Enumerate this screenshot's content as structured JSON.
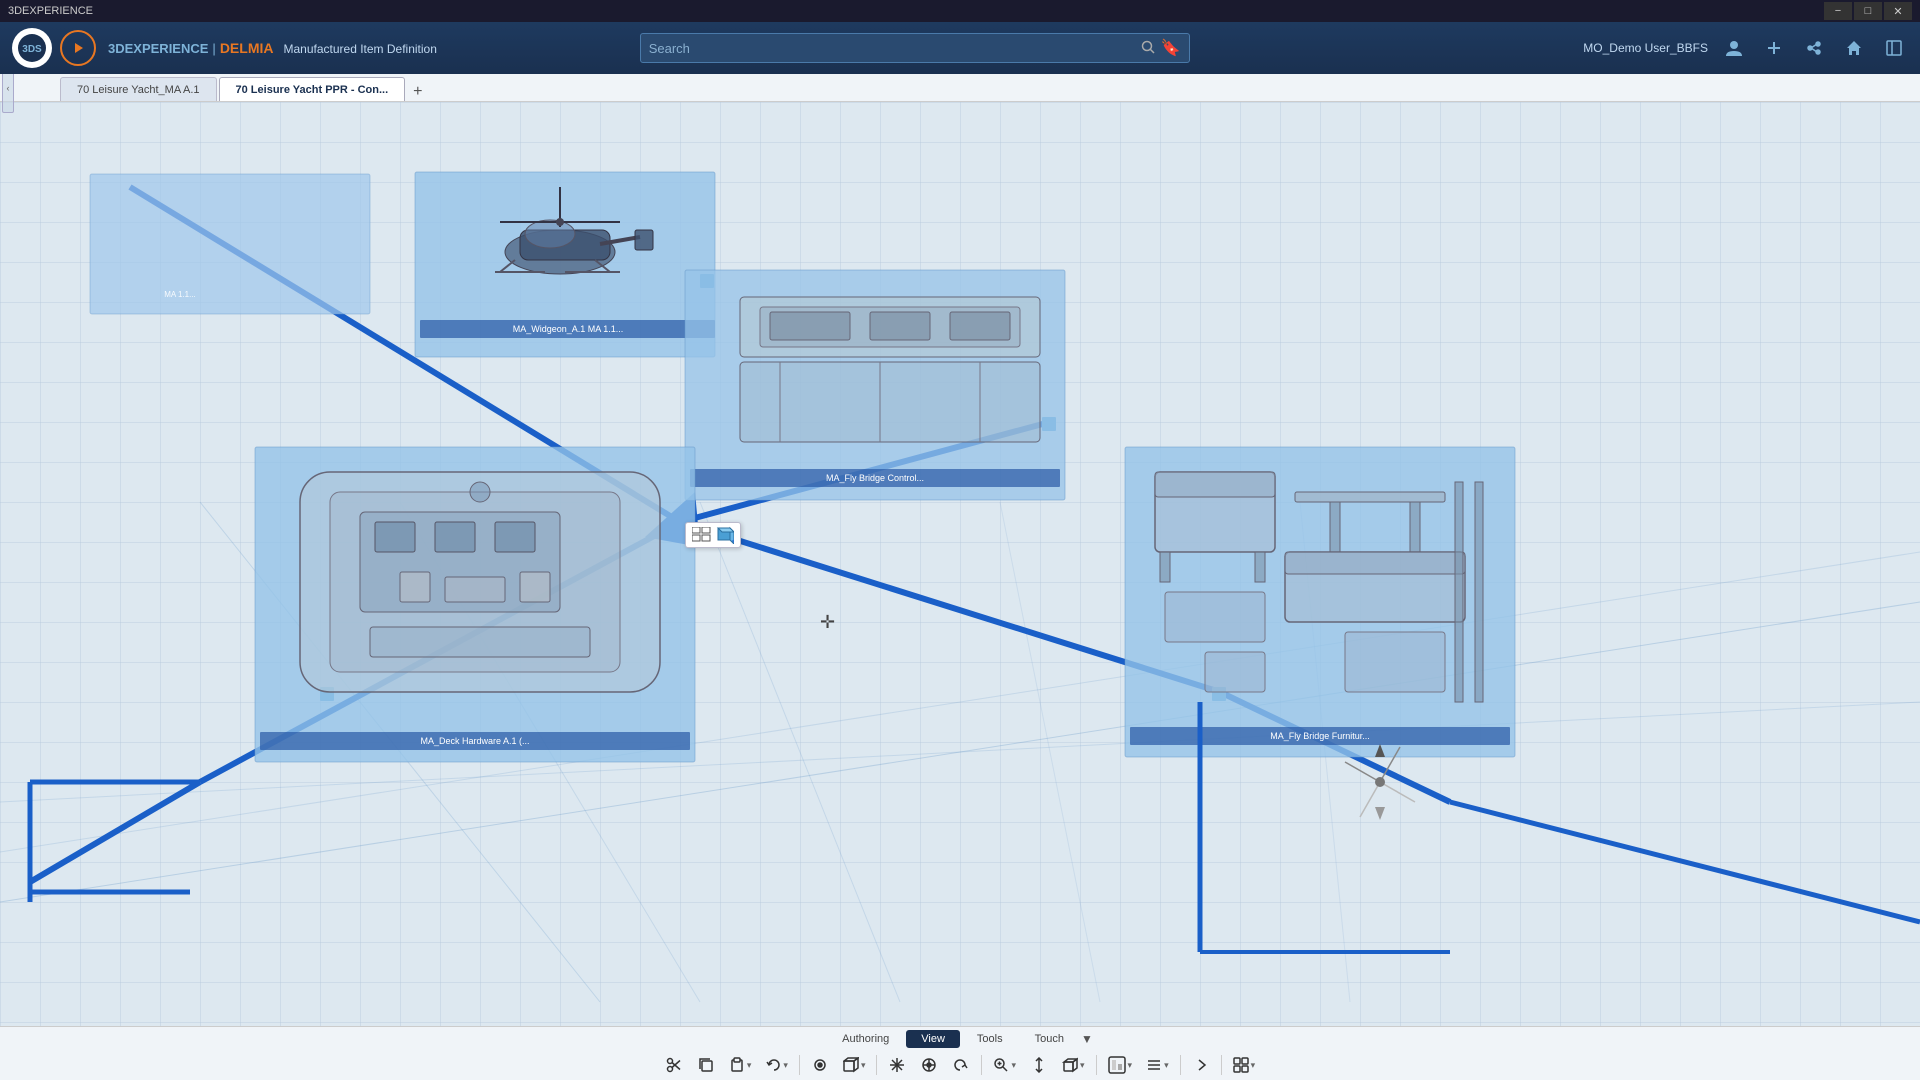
{
  "titlebar": {
    "title": "3DEXPERIENCE",
    "controls": [
      "minimize",
      "maximize",
      "close"
    ]
  },
  "header": {
    "brand_3dx": "3DEXPERIENCE",
    "separator": "|",
    "brand_delmia": "DELMIA",
    "module": "Manufactured Item Definition",
    "search_placeholder": "Search",
    "user": "MO_Demo User_BBFS",
    "icons": [
      "user",
      "plus",
      "share",
      "home",
      "expand"
    ]
  },
  "tabs": [
    {
      "label": "70 Leisure Yacht_MA A.1",
      "active": false
    },
    {
      "label": "70 Leisure Yacht PPR - Con...",
      "active": true
    }
  ],
  "cards": [
    {
      "id": "card-helicopter",
      "label": "MA_Widgeon_A.1 MA 1.1...",
      "has_indicator": true
    },
    {
      "id": "card-flybridge-ctrl",
      "label": "MA_Fly Bridge Control...",
      "has_indicator": true
    },
    {
      "id": "card-deck-hardware",
      "label": "MA_Deck Hardware A.1 (...",
      "has_indicator": true
    },
    {
      "id": "card-flybridge-furniture",
      "label": "MA_Fly Bridge Furnitur...",
      "has_indicator": true
    }
  ],
  "toolbar": {
    "tabs": [
      {
        "label": "Authoring",
        "active": false
      },
      {
        "label": "View",
        "active": true
      },
      {
        "label": "Tools",
        "active": false
      },
      {
        "label": "Touch",
        "active": false
      }
    ],
    "buttons": [
      {
        "icon": "✂",
        "label": "scissors",
        "has_dropdown": false
      },
      {
        "icon": "⬚",
        "label": "copy",
        "has_dropdown": false
      },
      {
        "icon": "⬚",
        "label": "paste",
        "has_dropdown": true
      },
      {
        "icon": "↶",
        "label": "undo",
        "has_dropdown": true
      },
      {
        "icon": "◎",
        "label": "fit",
        "has_dropdown": false
      },
      {
        "icon": "◻",
        "label": "cube-view",
        "has_dropdown": true
      },
      {
        "icon": "✛",
        "label": "multi-select",
        "has_dropdown": false
      },
      {
        "icon": "⊕",
        "label": "pan",
        "has_dropdown": false
      },
      {
        "icon": "↩",
        "label": "rotate-back",
        "has_dropdown": false
      },
      {
        "icon": "🔍",
        "label": "zoom",
        "has_dropdown": true
      },
      {
        "icon": "↕",
        "label": "pan-vertical",
        "has_dropdown": false
      },
      {
        "icon": "◼",
        "label": "view-cube",
        "has_dropdown": true
      },
      {
        "icon": "⬜",
        "label": "render-style",
        "has_dropdown": false
      },
      {
        "icon": "≡",
        "label": "section",
        "has_dropdown": true
      },
      {
        "icon": "▹",
        "label": "next",
        "has_dropdown": false
      },
      {
        "icon": "⊞",
        "label": "layout",
        "has_dropdown": true
      }
    ]
  },
  "mini_toolbar": {
    "icons": [
      "grid",
      "cube-add"
    ]
  },
  "compass": {
    "visible": true
  }
}
